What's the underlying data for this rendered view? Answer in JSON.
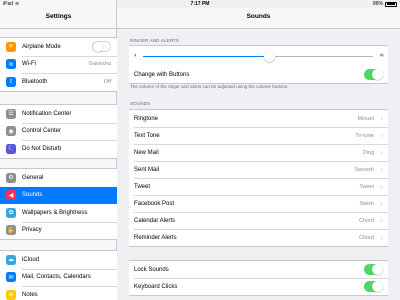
{
  "status_bar": {
    "device": "iPad",
    "time": "7:17 PM",
    "battery": "86%",
    "battery_level": 0.86
  },
  "master": {
    "title": "Settings",
    "groups": [
      [
        {
          "label": "Airplane Mode",
          "icon": "airplane-icon",
          "color": "#ff9500",
          "glyph": "✈",
          "toggle": false
        },
        {
          "label": "Wi-Fi",
          "icon": "wifi-icon",
          "color": "#007aff",
          "glyph": "≋",
          "value": "Ganesha"
        },
        {
          "label": "Bluetooth",
          "icon": "bluetooth-icon",
          "color": "#007aff",
          "glyph": "ᛒ",
          "value": "Off"
        }
      ],
      [
        {
          "label": "Notification Center",
          "icon": "notification-center-icon",
          "color": "#8e8e93",
          "glyph": "☰"
        },
        {
          "label": "Control Center",
          "icon": "control-center-icon",
          "color": "#8e8e93",
          "glyph": "◉"
        },
        {
          "label": "Do Not Disturb",
          "icon": "moon-icon",
          "color": "#5856d6",
          "glyph": "☾"
        }
      ],
      [
        {
          "label": "General",
          "icon": "gear-icon",
          "color": "#8e8e93",
          "glyph": "⚙"
        },
        {
          "label": "Sounds",
          "icon": "speaker-icon",
          "color": "#ff2d55",
          "glyph": "◀",
          "selected": true
        },
        {
          "label": "Wallpapers & Brightness",
          "icon": "wallpaper-icon",
          "color": "#34aadc",
          "glyph": "✿"
        },
        {
          "label": "Privacy",
          "icon": "hand-icon",
          "color": "#8e8e93",
          "glyph": "✋"
        }
      ],
      [
        {
          "label": "iCloud",
          "icon": "cloud-icon",
          "color": "#34aadc",
          "glyph": "☁"
        },
        {
          "label": "Mail, Contacts, Calendars",
          "icon": "mail-icon",
          "color": "#007aff",
          "glyph": "✉"
        },
        {
          "label": "Notes",
          "icon": "notes-icon",
          "color": "#ffcc00",
          "glyph": "≡"
        }
      ]
    ]
  },
  "detail": {
    "title": "Sounds",
    "ringer_section": "RINGER AND ALERTS",
    "volume_level": 0.55,
    "change_with_buttons": {
      "label": "Change with Buttons",
      "on": true
    },
    "ringer_footnote": "The volume of the ringer and alerts can be adjusted using the volume buttons.",
    "sounds_section": "SOUNDS",
    "sounds": [
      {
        "label": "Ringtone",
        "value": "Minuet"
      },
      {
        "label": "Text Tone",
        "value": "Tri-tone"
      },
      {
        "label": "New Mail",
        "value": "Ding"
      },
      {
        "label": "Sent Mail",
        "value": "Swoosh"
      },
      {
        "label": "Tweet",
        "value": "Tweet"
      },
      {
        "label": "Facebook Post",
        "value": "Swish"
      },
      {
        "label": "Calendar Alerts",
        "value": "Chord"
      },
      {
        "label": "Reminder Alerts",
        "value": "Chord"
      }
    ],
    "toggles": [
      {
        "label": "Lock Sounds",
        "on": true
      },
      {
        "label": "Keyboard Clicks",
        "on": true
      }
    ]
  }
}
